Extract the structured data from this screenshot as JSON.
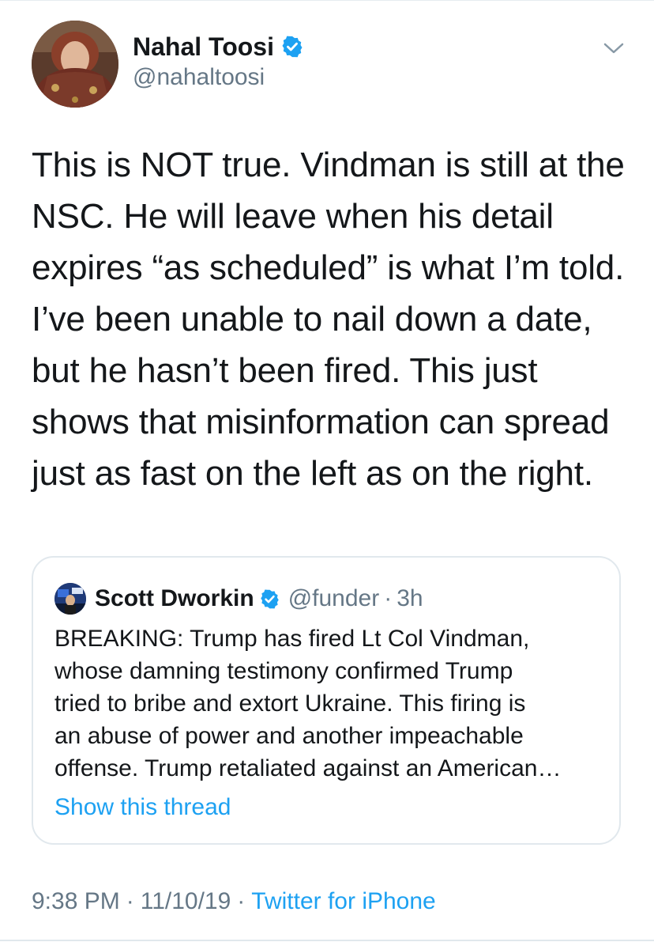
{
  "author": {
    "name": "Nahal Toosi",
    "handle": "@nahaltoosi",
    "verified": true,
    "avatar_icon": "profile-photo"
  },
  "tweet": {
    "text": "This is NOT true. Vindman is still at the\nNSC. He will leave when his detail\nexpires “as scheduled” is what I’m told.\nI’ve been unable to nail down a date,\nbut he hasn’t been fired. This just\nshows that misinformation can spread\njust as fast on the left as on the right."
  },
  "quoted_tweet": {
    "name": "Scott Dworkin",
    "handle": "@funder",
    "separator": "·",
    "time": "3h",
    "verified": true,
    "text": "BREAKING: Trump has fired Lt Col Vindman,\nwhose damning testimony confirmed Trump\ntried to bribe and extort Ukraine. This firing is\nan abuse of power and another impeachable\noffense. Trump retaliated against an American…",
    "show_thread_label": "Show this thread"
  },
  "meta": {
    "time": "9:38 PM",
    "date": "11/10/19",
    "separator": "·",
    "source": "Twitter for iPhone"
  },
  "colors": {
    "text": "#14171a",
    "secondary": "#657786",
    "accent": "#1da1f2",
    "border": "#e1e8ed"
  },
  "icons": {
    "verified": "verified-badge-icon",
    "caret": "chevron-down-icon"
  }
}
